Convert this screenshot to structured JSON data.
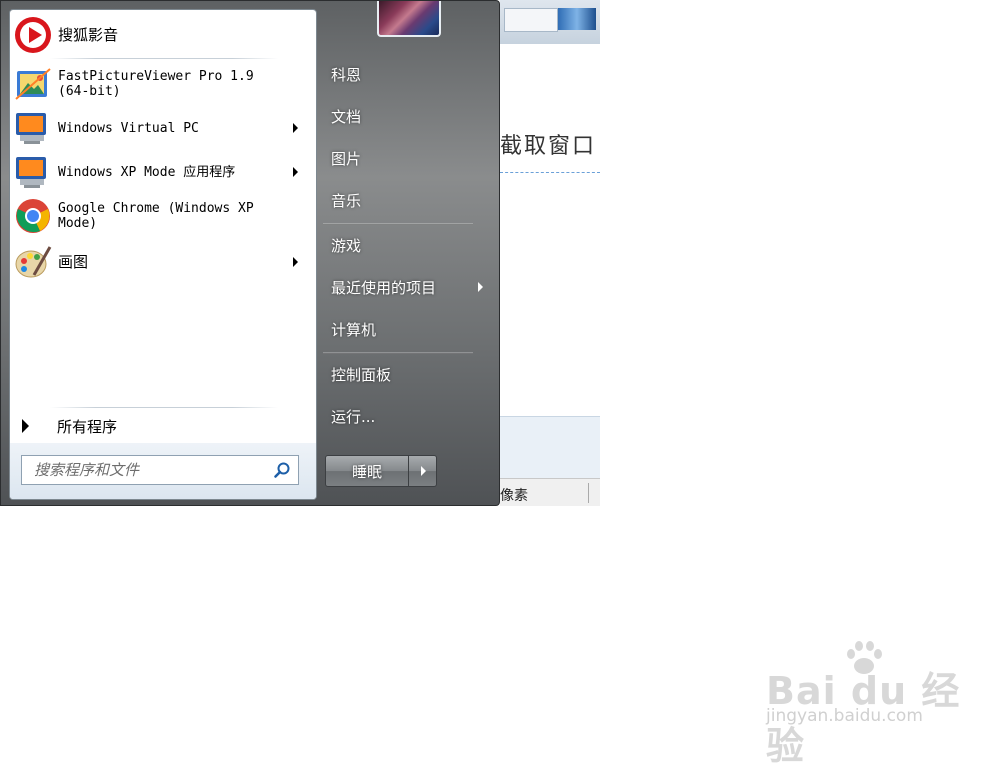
{
  "start_menu": {
    "pinned_programs": [
      {
        "label": "搜狐影音",
        "icon": "sohu-video-icon",
        "has_submenu": false
      },
      {
        "label": "FastPictureViewer Pro 1.9\n(64-bit)",
        "icon": "fastpictureviewer-icon",
        "has_submenu": false
      },
      {
        "label": "Windows Virtual PC",
        "icon": "virtual-pc-icon",
        "has_submenu": true
      },
      {
        "label": "Windows XP Mode 应用程序",
        "icon": "xp-mode-icon",
        "has_submenu": true
      },
      {
        "label": "Google Chrome (Windows XP\nMode)",
        "icon": "chrome-icon",
        "has_submenu": false
      },
      {
        "label": "画图",
        "icon": "paint-icon",
        "has_submenu": true
      }
    ],
    "all_programs_label": "所有程序",
    "search": {
      "placeholder": "搜索程序和文件"
    },
    "right_items": [
      {
        "label": "科恩",
        "has_submenu": false
      },
      {
        "label": "文档",
        "has_submenu": false
      },
      {
        "label": "图片",
        "has_submenu": false
      },
      {
        "label": "音乐",
        "has_submenu": false
      },
      {
        "label": "游戏",
        "has_submenu": false
      },
      {
        "label": "最近使用的项目",
        "has_submenu": true
      },
      {
        "label": "计算机",
        "has_submenu": false
      },
      {
        "label": "控制面板",
        "has_submenu": false
      },
      {
        "label": "运行...",
        "has_submenu": false
      }
    ],
    "shutdown_label": "睡眠"
  },
  "background_window": {
    "heading": "截取窗口",
    "status_text": "像素"
  },
  "watermark": {
    "main": "Bai du 经验",
    "sub": "jingyan.baidu.com"
  },
  "colors": {
    "accent_blue": "#2f6db5",
    "menu_dark": "#5e6163"
  }
}
